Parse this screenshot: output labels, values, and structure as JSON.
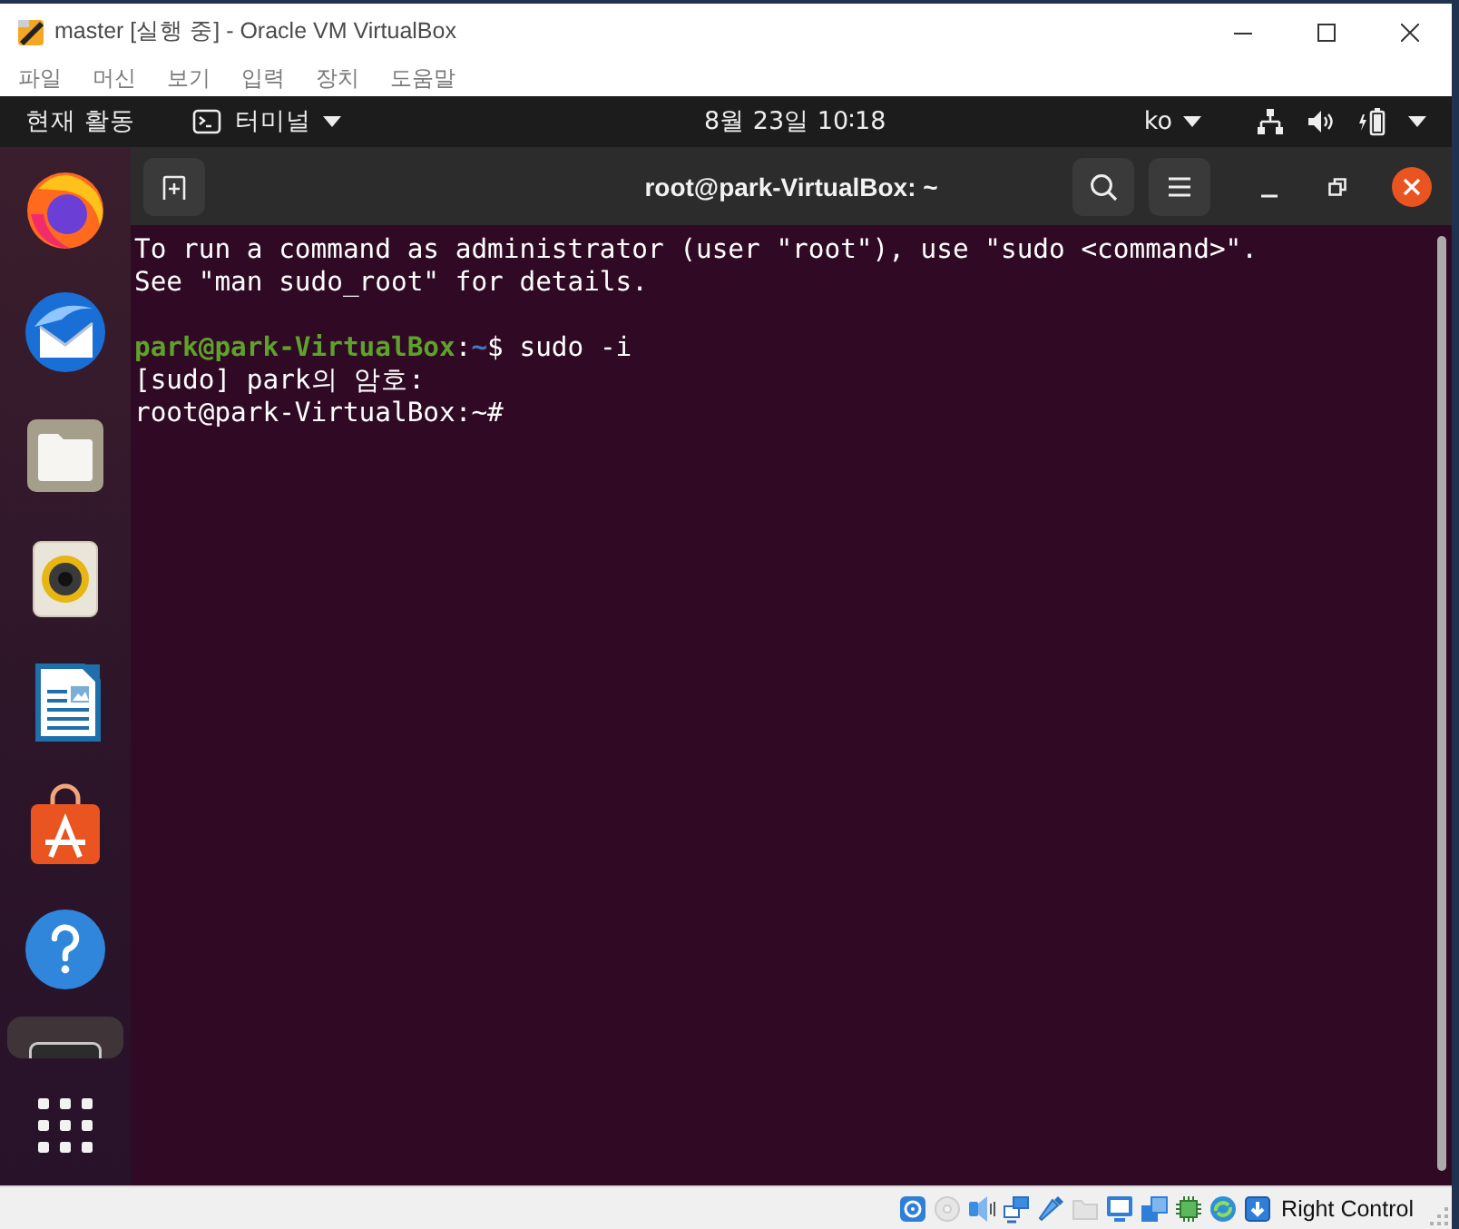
{
  "window": {
    "title": "master [실행 중] - Oracle VM VirtualBox"
  },
  "menu_bar": {
    "items": [
      "파일",
      "머신",
      "보기",
      "입력",
      "장치",
      "도움말"
    ]
  },
  "top_bar": {
    "activities": "현재 활동",
    "app_menu": "터미널",
    "clock": "8월 23일 10∶18",
    "input_source": "ko"
  },
  "dock": {
    "items": [
      {
        "kind": "firefox",
        "selected": false
      },
      {
        "kind": "thunderbird",
        "selected": false
      },
      {
        "kind": "files",
        "selected": false
      },
      {
        "kind": "rhythmbox",
        "selected": false
      },
      {
        "kind": "writer",
        "selected": false
      },
      {
        "kind": "software",
        "selected": false
      },
      {
        "kind": "help",
        "selected": false
      },
      {
        "kind": "terminal",
        "selected": true
      }
    ]
  },
  "terminal": {
    "title": "root@park-VirtualBox: ~",
    "blocks": [
      {
        "lines": [
          [
            {
              "kind": "plain",
              "text": "To run a command as administrator (user \"root\"), use \"sudo <command>\"."
            }
          ],
          [
            {
              "kind": "plain",
              "text": "See \"man sudo_root\" for details."
            }
          ]
        ]
      },
      {
        "lines": [
          [
            {
              "kind": "user",
              "text": "park@park-VirtualBox"
            },
            {
              "kind": "plain",
              "text": ":"
            },
            {
              "kind": "path",
              "text": "~"
            },
            {
              "kind": "plain",
              "text": "$ sudo -i"
            }
          ],
          [
            {
              "kind": "plain",
              "text": "[sudo] park의 암호:"
            }
          ],
          [
            {
              "kind": "plain",
              "text": "root@park-VirtualBox:~#"
            }
          ]
        ]
      }
    ]
  },
  "status_bar": {
    "indicators": [
      {
        "kind": "hard-disk",
        "disabled": false
      },
      {
        "kind": "optical",
        "disabled": true
      },
      {
        "kind": "audio",
        "disabled": false
      },
      {
        "kind": "network",
        "disabled": false
      },
      {
        "kind": "usb",
        "disabled": false
      },
      {
        "kind": "shared-folders",
        "disabled": true
      },
      {
        "kind": "display",
        "disabled": false
      },
      {
        "kind": "recording",
        "disabled": false
      },
      {
        "kind": "cpu",
        "disabled": false
      },
      {
        "kind": "mouse",
        "disabled": false
      },
      {
        "kind": "keyboard",
        "disabled": false
      }
    ],
    "host_key": "Right Control"
  }
}
